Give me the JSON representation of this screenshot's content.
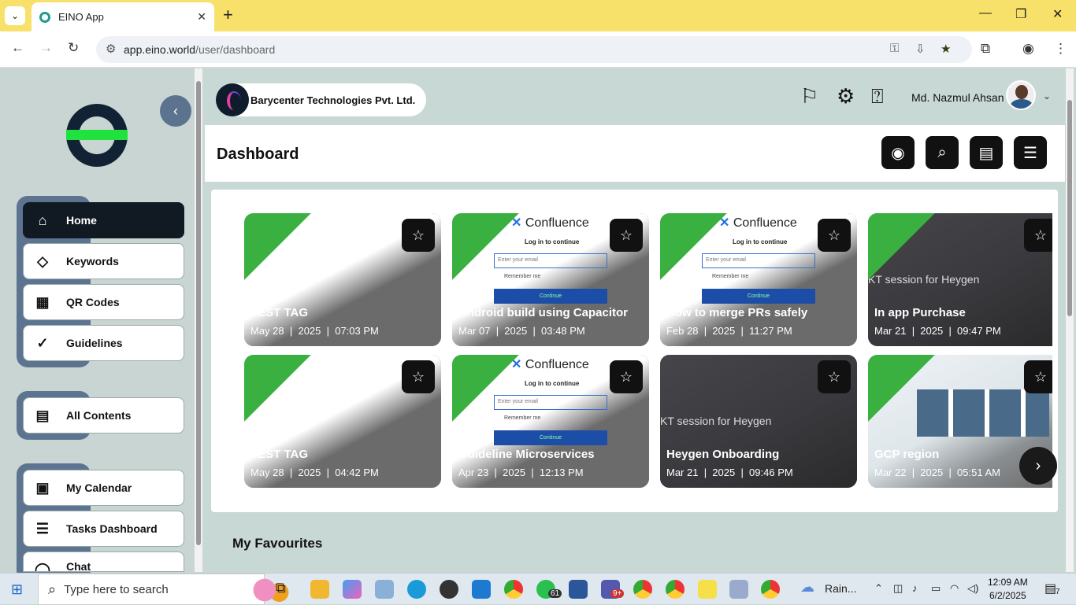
{
  "browser": {
    "tab_title": "EINO App",
    "url_domain": "app.eino.world",
    "url_path": "/user/dashboard"
  },
  "sidebar": {
    "items": [
      {
        "label": "Home",
        "icon": "home-icon",
        "active": true
      },
      {
        "label": "Keywords",
        "icon": "tag-icon"
      },
      {
        "label": "QR Codes",
        "icon": "qr-code-icon"
      },
      {
        "label": "Guidelines",
        "icon": "check-badge-icon"
      },
      {
        "label": "All Contents",
        "icon": "contents-icon"
      },
      {
        "label": "My Calendar",
        "icon": "calendar-icon"
      },
      {
        "label": "Tasks Dashboard",
        "icon": "tasks-icon"
      },
      {
        "label": "Chat",
        "icon": "chat-icon"
      }
    ]
  },
  "header": {
    "org_name": "Barycenter Technologies Pvt. Ltd.",
    "user_name": "Md. Nazmul Ahsan"
  },
  "dashboard": {
    "title": "Dashboard"
  },
  "cards": [
    {
      "title": "TEST TAG",
      "date": "May 28",
      "year": "2025",
      "time": "07:03 PM",
      "style": "light"
    },
    {
      "title": "Android build using Capacitor",
      "date": "Mar 07",
      "year": "2025",
      "time": "03:48 PM",
      "style": "confluence"
    },
    {
      "title": "How to merge PRs safely",
      "date": "Feb 28",
      "year": "2025",
      "time": "11:27 PM",
      "style": "confluence"
    },
    {
      "title": "In app Purchase",
      "date": "Mar 21",
      "year": "2025",
      "time": "09:47 PM",
      "style": "dark"
    },
    {
      "title": "TEST TAG",
      "date": "May 28",
      "year": "2025",
      "time": "04:42 PM",
      "style": "light"
    },
    {
      "title": "Guideline Microservices",
      "date": "Apr 23",
      "year": "2025",
      "time": "12:13 PM",
      "style": "confluence"
    },
    {
      "title": "Heygen Onboarding",
      "date": "Mar 21",
      "year": "2025",
      "time": "09:46 PM",
      "style": "dark"
    },
    {
      "title": "GCP region",
      "date": "Mar 22",
      "year": "2025",
      "time": "05:51 AM",
      "style": "screenshot"
    }
  ],
  "confluence": {
    "brand": "Confluence",
    "login_text": "Log in to continue",
    "email_placeholder": "Enter your email",
    "remember": "Remember me",
    "continue": "Continue"
  },
  "thumb_text": "KT session for Heygen",
  "favourites": {
    "title": "My Favourites"
  },
  "taskbar": {
    "search_placeholder": "Type here to search",
    "weather": "Rain...",
    "time": "12:09 AM",
    "date": "6/2/2025",
    "whatsapp_badge": "61",
    "teams_badge": "9+",
    "notif_count": "7"
  }
}
